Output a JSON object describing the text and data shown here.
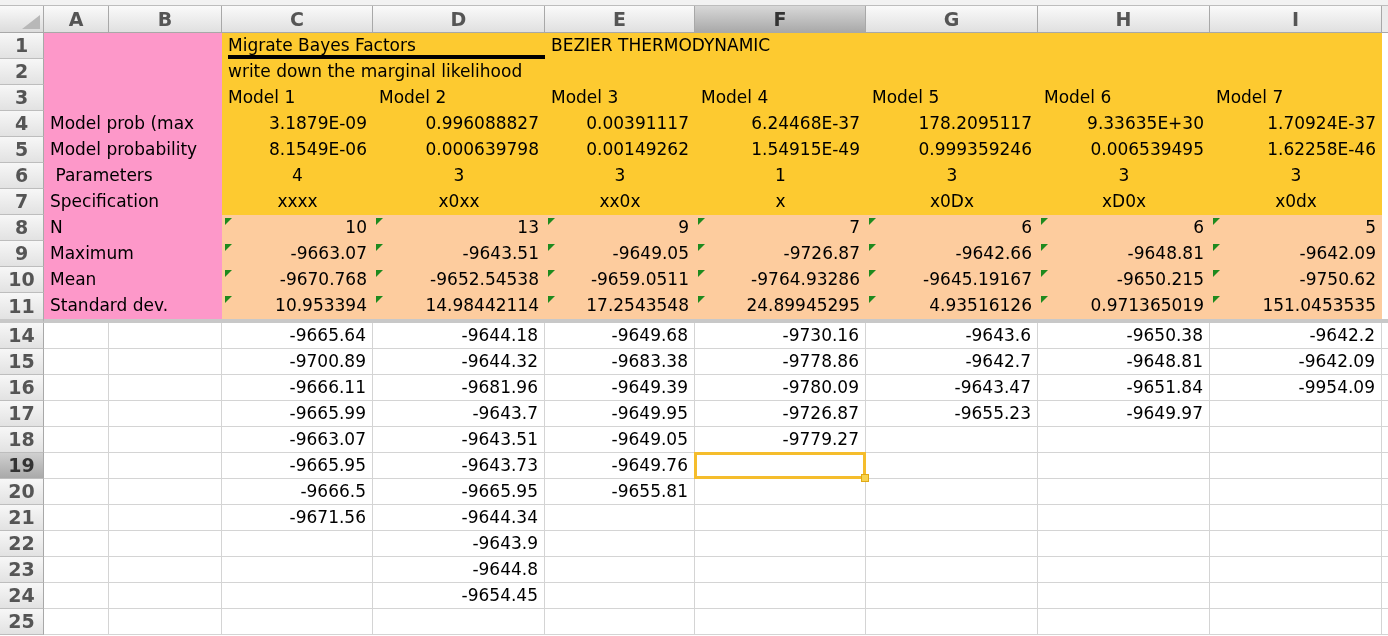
{
  "columns": [
    {
      "label": "A",
      "selected": false
    },
    {
      "label": "B",
      "selected": false
    },
    {
      "label": "C",
      "selected": false
    },
    {
      "label": "D",
      "selected": false
    },
    {
      "label": "E",
      "selected": false
    },
    {
      "label": "F",
      "selected": true
    },
    {
      "label": "G",
      "selected": false
    },
    {
      "label": "H",
      "selected": false
    },
    {
      "label": "I",
      "selected": false
    }
  ],
  "rows": [
    {
      "number": "1",
      "selected": false,
      "kind": "heading",
      "title_rule": true,
      "cells": [
        null,
        null,
        "Migrate Bayes Factors",
        null,
        "BEZIER THERMODYNAMIC",
        null,
        null,
        null,
        null
      ]
    },
    {
      "number": "2",
      "selected": false,
      "kind": "heading",
      "cells": [
        null,
        null,
        "write down the marginal likelihood",
        null,
        null,
        null,
        null,
        null,
        null
      ]
    },
    {
      "number": "3",
      "selected": false,
      "kind": "heading",
      "cells": [
        null,
        null,
        "Model 1",
        "Model 2",
        "Model 3",
        "Model 4",
        "Model 5",
        "Model 6",
        "Model 7"
      ]
    },
    {
      "number": "4",
      "selected": false,
      "kind": "probability",
      "cells": [
        "Model prob (max",
        null,
        "3.1879E-09",
        "0.996088827",
        "0.00391117",
        "6.24468E-37",
        "178.2095117",
        "9.33635E+30",
        "1.70924E-37"
      ]
    },
    {
      "number": "5",
      "selected": false,
      "kind": "probability",
      "cells": [
        "Model probability",
        null,
        "8.1549E-06",
        "0.000639798",
        "0.00149262",
        "1.54915E-49",
        "0.999359246",
        "0.006539495",
        "1.62258E-46"
      ]
    },
    {
      "number": "6",
      "selected": false,
      "kind": "attribute",
      "cells": [
        " Parameters",
        null,
        "4",
        "3",
        "3",
        "1",
        "3",
        "3",
        "3"
      ]
    },
    {
      "number": "7",
      "selected": false,
      "kind": "attribute",
      "cells": [
        "Specification",
        null,
        "xxxx",
        "x0xx",
        "xx0x",
        "x",
        "x0Dx",
        "xD0x",
        "x0dx"
      ]
    },
    {
      "number": "8",
      "selected": false,
      "kind": "statistic",
      "flagged": true,
      "cells": [
        "N",
        null,
        "10",
        "13",
        "9",
        "7",
        "6",
        "6",
        "5"
      ]
    },
    {
      "number": "9",
      "selected": false,
      "kind": "statistic",
      "flagged": true,
      "cells": [
        "Maximum",
        null,
        "-9663.07",
        "-9643.51",
        "-9649.05",
        "-9726.87",
        "-9642.66",
        "-9648.81",
        "-9642.09"
      ]
    },
    {
      "number": "10",
      "selected": false,
      "kind": "statistic",
      "flagged": true,
      "cells": [
        "Mean",
        null,
        "-9670.768",
        "-9652.54538",
        "-9659.0511",
        "-9764.93286",
        "-9645.19167",
        "-9650.215",
        "-9750.62"
      ]
    },
    {
      "number": "11",
      "selected": false,
      "kind": "statistic",
      "flagged": true,
      "cells": [
        "Standard dev.",
        null,
        "10.953394",
        "14.98442114",
        "17.2543548",
        "24.89945295",
        "4.93516126",
        "0.971365019",
        "151.0453535"
      ]
    },
    {
      "number": "14",
      "selected": false,
      "kind": "sample",
      "cells": [
        null,
        null,
        "-9665.64",
        "-9644.18",
        "-9649.68",
        "-9730.16",
        "-9643.6",
        "-9650.38",
        "-9642.2"
      ]
    },
    {
      "number": "15",
      "selected": false,
      "kind": "sample",
      "cells": [
        null,
        null,
        "-9700.89",
        "-9644.32",
        "-9683.38",
        "-9778.86",
        "-9642.7",
        "-9648.81",
        "-9642.09"
      ]
    },
    {
      "number": "16",
      "selected": false,
      "kind": "sample",
      "cells": [
        null,
        null,
        "-9666.11",
        "-9681.96",
        "-9649.39",
        "-9780.09",
        "-9643.47",
        "-9651.84",
        "-9954.09"
      ]
    },
    {
      "number": "17",
      "selected": false,
      "kind": "sample",
      "cells": [
        null,
        null,
        "-9665.99",
        "-9643.7",
        "-9649.95",
        "-9726.87",
        "-9655.23",
        "-9649.97",
        null
      ]
    },
    {
      "number": "18",
      "selected": false,
      "kind": "sample",
      "cells": [
        null,
        null,
        "-9663.07",
        "-9643.51",
        "-9649.05",
        "-9779.27",
        null,
        null,
        null
      ]
    },
    {
      "number": "19",
      "selected": true,
      "kind": "sample",
      "cells": [
        null,
        null,
        "-9665.95",
        "-9643.73",
        "-9649.76",
        null,
        null,
        null,
        null
      ]
    },
    {
      "number": "20",
      "selected": false,
      "kind": "sample",
      "cells": [
        null,
        null,
        "-9666.5",
        "-9665.95",
        "-9655.81",
        null,
        null,
        null,
        null
      ]
    },
    {
      "number": "21",
      "selected": false,
      "kind": "sample",
      "cells": [
        null,
        null,
        "-9671.56",
        "-9644.34",
        null,
        null,
        null,
        null,
        null
      ]
    },
    {
      "number": "22",
      "selected": false,
      "kind": "sample",
      "cells": [
        null,
        null,
        null,
        "-9643.9",
        null,
        null,
        null,
        null,
        null
      ]
    },
    {
      "number": "23",
      "selected": false,
      "kind": "sample",
      "cells": [
        null,
        null,
        null,
        "-9644.8",
        null,
        null,
        null,
        null,
        null
      ]
    },
    {
      "number": "24",
      "selected": false,
      "kind": "sample",
      "cells": [
        null,
        null,
        null,
        "-9654.45",
        null,
        null,
        null,
        null,
        null
      ]
    },
    {
      "number": "25",
      "selected": false,
      "kind": "sample",
      "cells": [
        null,
        null,
        null,
        null,
        null,
        null,
        null,
        null,
        null
      ]
    }
  ]
}
